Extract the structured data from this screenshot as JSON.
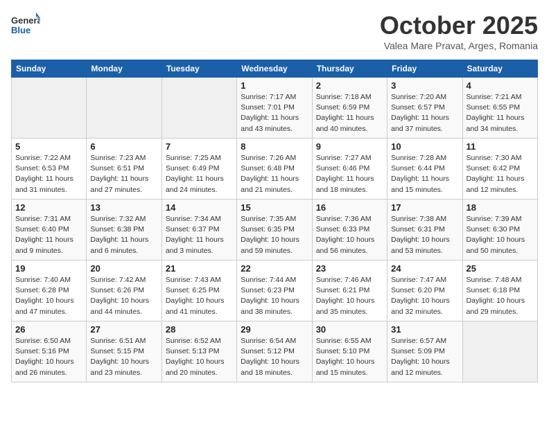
{
  "header": {
    "logo_general": "General",
    "logo_blue": "Blue",
    "month_year": "October 2025",
    "location": "Valea Mare Pravat, Arges, Romania"
  },
  "weekdays": [
    "Sunday",
    "Monday",
    "Tuesday",
    "Wednesday",
    "Thursday",
    "Friday",
    "Saturday"
  ],
  "weeks": [
    [
      {
        "day": "",
        "empty": true
      },
      {
        "day": "",
        "empty": true
      },
      {
        "day": "",
        "empty": true
      },
      {
        "day": "1",
        "sunrise": "7:17 AM",
        "sunset": "7:01 PM",
        "daylight": "11 hours and 43 minutes."
      },
      {
        "day": "2",
        "sunrise": "7:18 AM",
        "sunset": "6:59 PM",
        "daylight": "11 hours and 40 minutes."
      },
      {
        "day": "3",
        "sunrise": "7:20 AM",
        "sunset": "6:57 PM",
        "daylight": "11 hours and 37 minutes."
      },
      {
        "day": "4",
        "sunrise": "7:21 AM",
        "sunset": "6:55 PM",
        "daylight": "11 hours and 34 minutes."
      }
    ],
    [
      {
        "day": "5",
        "sunrise": "7:22 AM",
        "sunset": "6:53 PM",
        "daylight": "11 hours and 31 minutes."
      },
      {
        "day": "6",
        "sunrise": "7:23 AM",
        "sunset": "6:51 PM",
        "daylight": "11 hours and 27 minutes."
      },
      {
        "day": "7",
        "sunrise": "7:25 AM",
        "sunset": "6:49 PM",
        "daylight": "11 hours and 24 minutes."
      },
      {
        "day": "8",
        "sunrise": "7:26 AM",
        "sunset": "6:48 PM",
        "daylight": "11 hours and 21 minutes."
      },
      {
        "day": "9",
        "sunrise": "7:27 AM",
        "sunset": "6:46 PM",
        "daylight": "11 hours and 18 minutes."
      },
      {
        "day": "10",
        "sunrise": "7:28 AM",
        "sunset": "6:44 PM",
        "daylight": "11 hours and 15 minutes."
      },
      {
        "day": "11",
        "sunrise": "7:30 AM",
        "sunset": "6:42 PM",
        "daylight": "11 hours and 12 minutes."
      }
    ],
    [
      {
        "day": "12",
        "sunrise": "7:31 AM",
        "sunset": "6:40 PM",
        "daylight": "11 hours and 9 minutes."
      },
      {
        "day": "13",
        "sunrise": "7:32 AM",
        "sunset": "6:38 PM",
        "daylight": "11 hours and 6 minutes."
      },
      {
        "day": "14",
        "sunrise": "7:34 AM",
        "sunset": "6:37 PM",
        "daylight": "11 hours and 3 minutes."
      },
      {
        "day": "15",
        "sunrise": "7:35 AM",
        "sunset": "6:35 PM",
        "daylight": "10 hours and 59 minutes."
      },
      {
        "day": "16",
        "sunrise": "7:36 AM",
        "sunset": "6:33 PM",
        "daylight": "10 hours and 56 minutes."
      },
      {
        "day": "17",
        "sunrise": "7:38 AM",
        "sunset": "6:31 PM",
        "daylight": "10 hours and 53 minutes."
      },
      {
        "day": "18",
        "sunrise": "7:39 AM",
        "sunset": "6:30 PM",
        "daylight": "10 hours and 50 minutes."
      }
    ],
    [
      {
        "day": "19",
        "sunrise": "7:40 AM",
        "sunset": "6:28 PM",
        "daylight": "10 hours and 47 minutes."
      },
      {
        "day": "20",
        "sunrise": "7:42 AM",
        "sunset": "6:26 PM",
        "daylight": "10 hours and 44 minutes."
      },
      {
        "day": "21",
        "sunrise": "7:43 AM",
        "sunset": "6:25 PM",
        "daylight": "10 hours and 41 minutes."
      },
      {
        "day": "22",
        "sunrise": "7:44 AM",
        "sunset": "6:23 PM",
        "daylight": "10 hours and 38 minutes."
      },
      {
        "day": "23",
        "sunrise": "7:46 AM",
        "sunset": "6:21 PM",
        "daylight": "10 hours and 35 minutes."
      },
      {
        "day": "24",
        "sunrise": "7:47 AM",
        "sunset": "6:20 PM",
        "daylight": "10 hours and 32 minutes."
      },
      {
        "day": "25",
        "sunrise": "7:48 AM",
        "sunset": "6:18 PM",
        "daylight": "10 hours and 29 minutes."
      }
    ],
    [
      {
        "day": "26",
        "sunrise": "6:50 AM",
        "sunset": "5:16 PM",
        "daylight": "10 hours and 26 minutes."
      },
      {
        "day": "27",
        "sunrise": "6:51 AM",
        "sunset": "5:15 PM",
        "daylight": "10 hours and 23 minutes."
      },
      {
        "day": "28",
        "sunrise": "6:52 AM",
        "sunset": "5:13 PM",
        "daylight": "10 hours and 20 minutes."
      },
      {
        "day": "29",
        "sunrise": "6:54 AM",
        "sunset": "5:12 PM",
        "daylight": "10 hours and 18 minutes."
      },
      {
        "day": "30",
        "sunrise": "6:55 AM",
        "sunset": "5:10 PM",
        "daylight": "10 hours and 15 minutes."
      },
      {
        "day": "31",
        "sunrise": "6:57 AM",
        "sunset": "5:09 PM",
        "daylight": "10 hours and 12 minutes."
      },
      {
        "day": "",
        "empty": true
      }
    ]
  ]
}
